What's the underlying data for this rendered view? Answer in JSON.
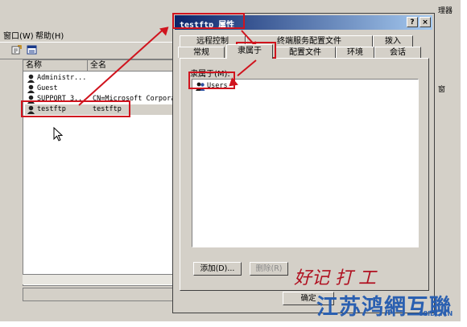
{
  "menubar": {
    "items": [
      "窗口(W)",
      "帮助(H)"
    ]
  },
  "list": {
    "columns": [
      "名称",
      "全名"
    ],
    "rows": [
      {
        "name": "Administr...",
        "full": ""
      },
      {
        "name": "Guest",
        "full": ""
      },
      {
        "name": "SUPPORT_3...",
        "full": "CN=Microsoft Corpora..."
      },
      {
        "name": "testftp",
        "full": "testftp"
      }
    ]
  },
  "dialog": {
    "title": "testftp 属性",
    "help_btn": "?",
    "close_btn": "×",
    "tabs_row1": [
      "远程控制",
      "终端服务配置文件",
      "拨入"
    ],
    "tabs_row2": [
      "常规",
      "隶属于",
      "配置文件",
      "环境",
      "会话"
    ],
    "member_label": "隶属于(M):",
    "members": [
      "Users"
    ],
    "add_button": "添加(D)...",
    "remove_button": "删除(R)",
    "ok_button": "确定"
  },
  "right_edge_texts": [
    "理器",
    "窗"
  ],
  "watermark": {
    "line1": "好记  打  工",
    "line2": "江苏鸿網互聯",
    "line3": "68IDC.CN"
  },
  "colors": {
    "title_start": "#0a246a",
    "title_end": "#a6caf0",
    "annotation": "#d0141e",
    "watermark_blue": "#2a5fb0"
  }
}
